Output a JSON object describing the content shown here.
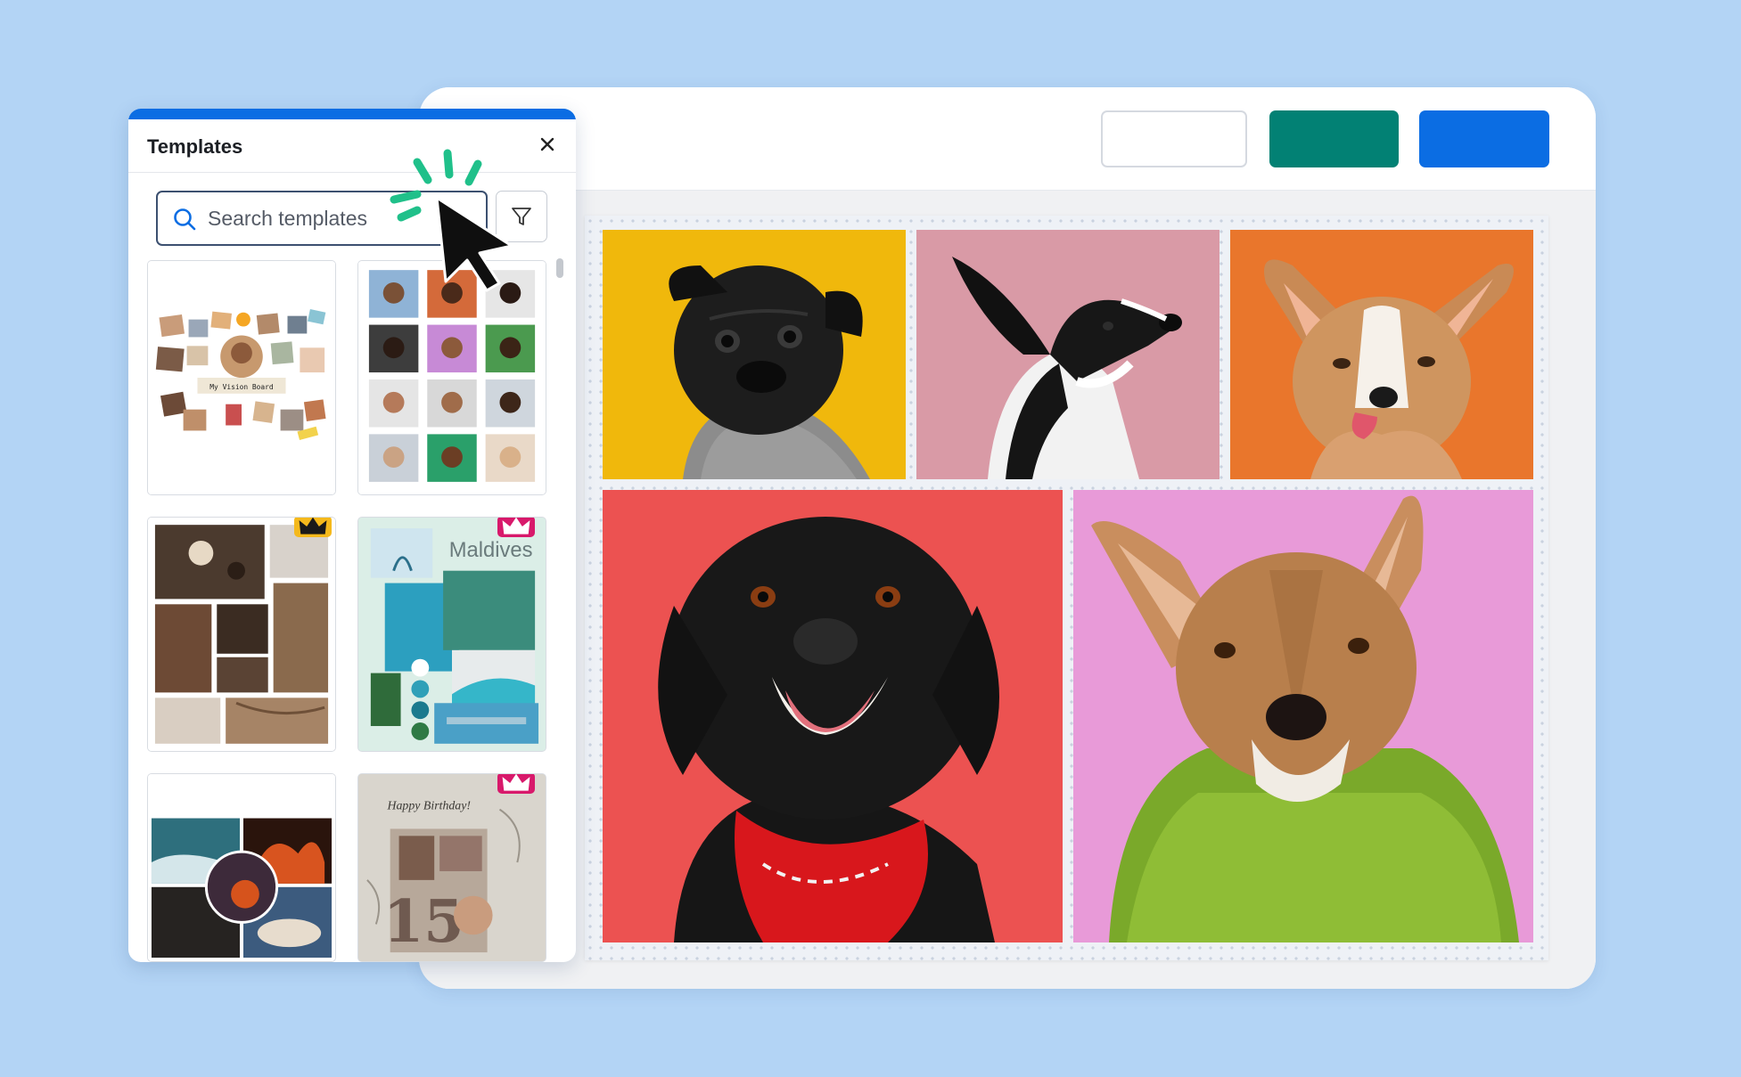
{
  "panel": {
    "title": "Templates",
    "search": {
      "placeholder": "Search templates",
      "value": ""
    },
    "templates": [
      {
        "name": "vision-board",
        "caption": "My Vision Board",
        "premium": false
      },
      {
        "name": "portrait-grid",
        "premium": false
      },
      {
        "name": "moody-brown",
        "premium": true,
        "badge": "gold"
      },
      {
        "name": "maldives",
        "caption": "Maldives",
        "premium": true,
        "badge": "pink"
      },
      {
        "name": "ocean-fire",
        "premium": false
      },
      {
        "name": "happy-birthday",
        "caption": "Happy Birthday!",
        "number": "15",
        "premium": true,
        "badge": "pink"
      }
    ]
  },
  "toolbar": {
    "buttons": [
      "outline",
      "teal",
      "blue"
    ]
  },
  "colors": {
    "background": "#b3d4f5",
    "accent_blue": "#0b6de3",
    "accent_teal": "#028174",
    "sparkle_green": "#20c08a",
    "crown_gold": "#f5b91c",
    "crown_pink": "#d8196b"
  },
  "canvas": {
    "photos": [
      {
        "subject": "black pug",
        "bg": "#f0b80c"
      },
      {
        "subject": "black and white dog",
        "bg": "#d99aa6"
      },
      {
        "subject": "corgi puppy",
        "bg": "#e9762c"
      },
      {
        "subject": "black dog with red bandana",
        "bg": "#ec5251"
      },
      {
        "subject": "tan dog with green boa",
        "bg": "#e89ad8"
      }
    ]
  },
  "icons": [
    "search-icon",
    "filter-icon",
    "close-icon",
    "crown-icon",
    "cursor-icon"
  ]
}
